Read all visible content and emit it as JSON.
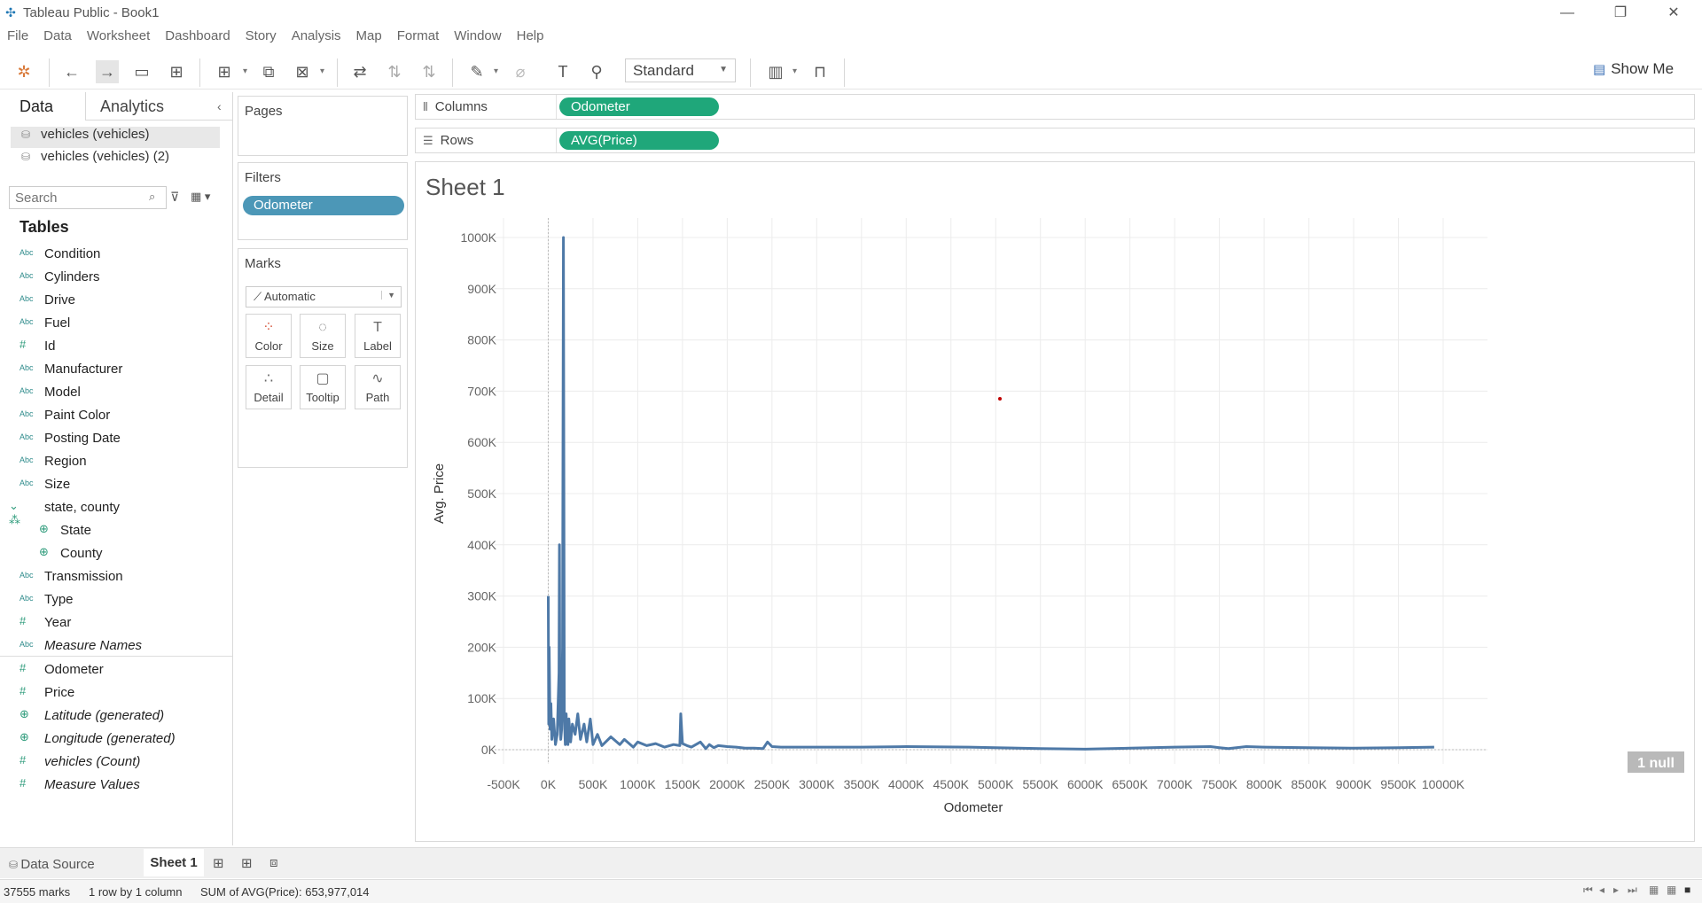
{
  "window": {
    "title": "Tableau Public - Book1",
    "minimize": "—",
    "restore": "❐",
    "close": "✕"
  },
  "menu": [
    "File",
    "Data",
    "Worksheet",
    "Dashboard",
    "Story",
    "Analysis",
    "Map",
    "Format",
    "Window",
    "Help"
  ],
  "toolbar": {
    "fit_mode": "Standard",
    "show_me": "Show Me"
  },
  "left_panel": {
    "tab_data": "Data",
    "tab_analytics": "Analytics",
    "datasources": [
      "vehicles (vehicles)",
      "vehicles (vehicles) (2)"
    ],
    "search_placeholder": "Search",
    "tables_heading": "Tables",
    "fields": [
      {
        "type": "Abc",
        "name": "Condition"
      },
      {
        "type": "Abc",
        "name": "Cylinders"
      },
      {
        "type": "Abc",
        "name": "Drive"
      },
      {
        "type": "Abc",
        "name": "Fuel"
      },
      {
        "type": "#",
        "name": "Id"
      },
      {
        "type": "Abc",
        "name": "Manufacturer"
      },
      {
        "type": "Abc",
        "name": "Model"
      },
      {
        "type": "Abc",
        "name": "Paint Color"
      },
      {
        "type": "Abc",
        "name": "Posting Date"
      },
      {
        "type": "Abc",
        "name": "Region"
      },
      {
        "type": "Abc",
        "name": "Size"
      },
      {
        "type": "hier",
        "name": "state, county"
      },
      {
        "type": "geo",
        "name": "State"
      },
      {
        "type": "geo",
        "name": "County"
      },
      {
        "type": "Abc",
        "name": "Transmission"
      },
      {
        "type": "Abc",
        "name": "Type"
      },
      {
        "type": "#",
        "name": "Year"
      },
      {
        "type": "Abc",
        "name": "Measure Names"
      },
      {
        "type": "#",
        "name": "Odometer"
      },
      {
        "type": "#",
        "name": "Price"
      },
      {
        "type": "geo",
        "name": "Latitude (generated)"
      },
      {
        "type": "geo",
        "name": "Longitude (generated)"
      },
      {
        "type": "#",
        "name": "vehicles (Count)"
      },
      {
        "type": "#",
        "name": "Measure Values"
      }
    ]
  },
  "cards": {
    "pages": "Pages",
    "filters": "Filters",
    "filter_pill": "Odometer",
    "marks": "Marks",
    "mark_type": "Automatic",
    "mark_buttons": [
      "Color",
      "Size",
      "Label",
      "Detail",
      "Tooltip",
      "Path"
    ]
  },
  "shelves": {
    "columns_label": "Columns",
    "columns_pill": "Odometer",
    "rows_label": "Rows",
    "rows_pill": "AVG(Price)"
  },
  "sheet": {
    "title": "Sheet 1",
    "null_badge": "1 null"
  },
  "chart_data": {
    "type": "line",
    "xlabel": "Odometer",
    "ylabel": "Avg. Price",
    "xlim": [
      -500000,
      10000000
    ],
    "ylim": [
      0,
      1000000
    ],
    "xticks": [
      "-500K",
      "0K",
      "500K",
      "1000K",
      "1500K",
      "2000K",
      "2500K",
      "3000K",
      "3500K",
      "4000K",
      "4500K",
      "5000K",
      "5500K",
      "6000K",
      "6500K",
      "7000K",
      "7500K",
      "8000K",
      "8500K",
      "9000K",
      "9500K",
      "10000K"
    ],
    "yticks": [
      "0K",
      "100K",
      "200K",
      "300K",
      "400K",
      "500K",
      "600K",
      "700K",
      "800K",
      "900K",
      "1000K"
    ],
    "grid": true,
    "series": [
      {
        "color": "#4e79a7",
        "x": [
          0,
          5000,
          10000,
          15000,
          20000,
          30000,
          40000,
          60000,
          80000,
          100000,
          120000,
          125000,
          130000,
          140000,
          150000,
          160000,
          170000,
          180000,
          190000,
          200000,
          210000,
          215000,
          220000,
          230000,
          250000,
          270000,
          300000,
          330000,
          360000,
          400000,
          430000,
          470000,
          500000,
          550000,
          600000,
          700000,
          800000,
          850000,
          950000,
          1000000,
          1100000,
          1200000,
          1300000,
          1400000,
          1470000,
          1480000,
          1500000,
          1550000,
          1600000,
          1700000,
          1760000,
          1800000,
          1850000,
          1900000,
          2000000,
          2100000,
          2200000,
          2300000,
          2400000,
          2450000,
          2500000,
          2600000,
          2650000,
          2700000,
          3000000,
          3500000,
          4000000,
          4700000,
          5000000,
          5500000,
          6000000,
          6500000,
          7000000,
          7400000,
          7500000,
          7600000,
          7800000,
          8000000,
          8500000,
          9000000,
          9500000,
          9900000
        ],
        "y": [
          300000,
          50000,
          200000,
          120000,
          40000,
          90000,
          20000,
          60000,
          10000,
          30000,
          150000,
          400000,
          60000,
          20000,
          40000,
          200000,
          1000000,
          60000,
          10000,
          70000,
          20000,
          40000,
          10000,
          60000,
          15000,
          50000,
          30000,
          70000,
          20000,
          50000,
          15000,
          60000,
          10000,
          30000,
          8000,
          25000,
          10000,
          20000,
          5000,
          15000,
          8000,
          12000,
          5000,
          10000,
          8000,
          70000,
          12000,
          8000,
          5000,
          15000,
          2000,
          10000,
          4000,
          8000,
          6000,
          5000,
          3000,
          3000,
          2000,
          15000,
          6000,
          5000,
          5000,
          5000,
          5000,
          5000,
          6000,
          5000,
          4000,
          2000,
          1000,
          3000,
          5000,
          6000,
          4000,
          2000,
          6000,
          5000,
          4000,
          3000,
          4000,
          5000
        ]
      }
    ]
  },
  "bottom": {
    "datasource_tab": "Data Source",
    "sheet_tab": "Sheet 1",
    "status_marks": "37555 marks",
    "status_rows": "1 row by 1 column",
    "status_sum": "SUM of AVG(Price): 653,977,014"
  }
}
